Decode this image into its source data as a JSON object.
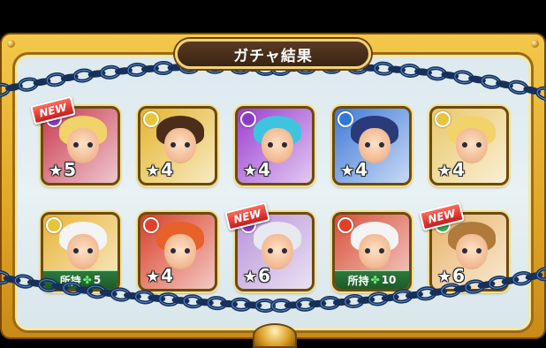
{
  "title": "ガチャ結果",
  "colors": {
    "frame": "#e0a524",
    "plate": "#3a2414",
    "chain": "#1a3a6a",
    "owned": "#1d5a2a",
    "new": "#c71d1d"
  },
  "cards": [
    {
      "id": 1,
      "rarity": "5",
      "new_label": "NEW",
      "element": "dark",
      "bg": "#c83b50",
      "hair": "#f2d36a",
      "owned_label": "",
      "owned_count": ""
    },
    {
      "id": 2,
      "rarity": "4",
      "new_label": "",
      "element": "light",
      "bg": "#e4b52c",
      "hair": "#4a2e1a",
      "owned_label": "",
      "owned_count": ""
    },
    {
      "id": 3,
      "rarity": "4",
      "new_label": "",
      "element": "dark",
      "bg": "#9b3fd0",
      "hair": "#3fc4e0",
      "owned_label": "",
      "owned_count": ""
    },
    {
      "id": 4,
      "rarity": "4",
      "new_label": "",
      "element": "water",
      "bg": "#3f7ad8",
      "hair": "#2a3a7a",
      "owned_label": "",
      "owned_count": ""
    },
    {
      "id": 5,
      "rarity": "4",
      "new_label": "",
      "element": "light",
      "bg": "#e9c86a",
      "hair": "#f2d36a",
      "owned_label": "",
      "owned_count": ""
    },
    {
      "id": 6,
      "rarity": "",
      "new_label": "",
      "element": "light",
      "bg": "#e8b43a",
      "hair": "#f4f4f4",
      "owned_label": "所持",
      "owned_count": "5"
    },
    {
      "id": 7,
      "rarity": "4",
      "new_label": "",
      "element": "fire",
      "bg": "#d8402a",
      "hair": "#e8602a",
      "owned_label": "",
      "owned_count": ""
    },
    {
      "id": 8,
      "rarity": "6",
      "new_label": "NEW",
      "element": "dark",
      "bg": "#b894d8",
      "hair": "#e8e8f0",
      "owned_label": "",
      "owned_count": ""
    },
    {
      "id": 9,
      "rarity": "",
      "new_label": "",
      "element": "fire",
      "bg": "#d8503a",
      "hair": "#f4f4f4",
      "owned_label": "所持",
      "owned_count": "10"
    },
    {
      "id": 10,
      "rarity": "6",
      "new_label": "NEW",
      "element": "wood",
      "bg": "#e8b46a",
      "hair": "#b07a3a",
      "owned_label": "",
      "owned_count": ""
    }
  ]
}
